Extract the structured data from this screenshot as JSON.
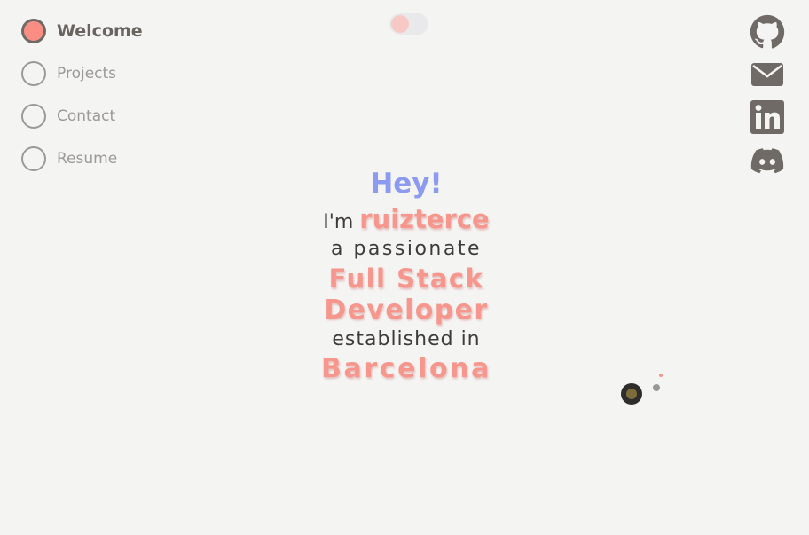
{
  "nav": {
    "items": [
      {
        "label": "Welcome",
        "active": true
      },
      {
        "label": "Projects",
        "active": false
      },
      {
        "label": "Contact",
        "active": false
      },
      {
        "label": "Resume",
        "active": false
      }
    ]
  },
  "theme_toggle": {
    "state": "off"
  },
  "social": {
    "icons": [
      "github-icon",
      "mail-icon",
      "linkedin-icon",
      "discord-icon"
    ],
    "icon_color": "#6f6a66"
  },
  "hero": {
    "greeting": "Hey!",
    "im": "I'm",
    "name": "ruizterce",
    "passionate": "a passionate",
    "role_line1": "Full Stack",
    "role_line2": "Developer",
    "established": "established in",
    "city": "Barcelona"
  },
  "colors": {
    "background": "#f4f4f3",
    "accent_pink": "#f6968c",
    "accent_blue": "#8c9bf0",
    "text_dark": "#3e3c3b",
    "nav_muted": "#9c9a98"
  }
}
